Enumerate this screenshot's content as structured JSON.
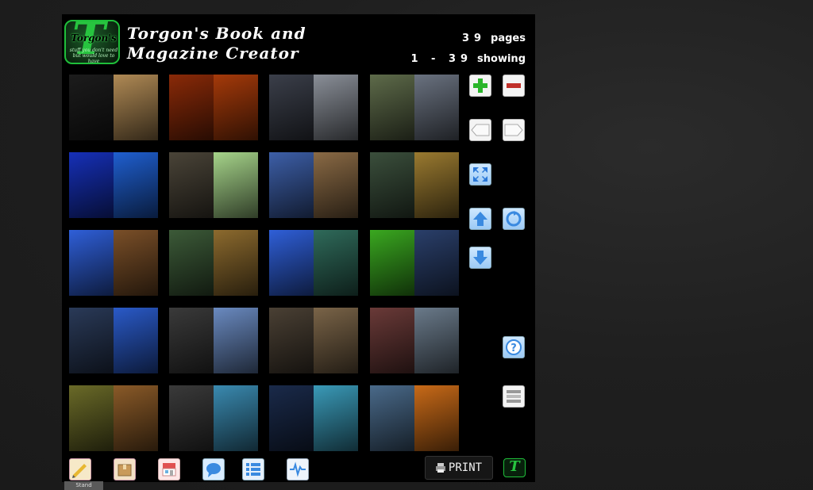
{
  "header": {
    "logo_word": "Torgon's",
    "logo_tagline": "stuff you don't need but would love to have",
    "title_line1": "Torgon's Book and",
    "title_line2": "Magazine Creator",
    "pages_count": "39",
    "pages_label": "pages",
    "showing_range": "1 - 39",
    "showing_label": "showing"
  },
  "thumbnails": [
    {
      "name": "page-1-2",
      "left": "#1c1c1c",
      "right": "#b08a55"
    },
    {
      "name": "page-3-4",
      "left": "#8a2a08",
      "right": "#a53a0a"
    },
    {
      "name": "page-5-6",
      "left": "#3b3f4a",
      "right": "#8a8f98"
    },
    {
      "name": "page-7-8",
      "left": "#5e6b4a",
      "right": "#6a7280"
    },
    {
      "name": "page-9-10",
      "left": "#1630b8",
      "right": "#1f5fd0"
    },
    {
      "name": "page-11-12",
      "left": "#4a4438",
      "right": "#a6d48a"
    },
    {
      "name": "page-13-14",
      "left": "#3d5fa8",
      "right": "#8a6a45"
    },
    {
      "name": "page-15-16",
      "left": "#3b4f3c",
      "right": "#9a7a30"
    },
    {
      "name": "page-17-18",
      "left": "#2f5fd8",
      "right": "#7a4f28"
    },
    {
      "name": "page-19-20",
      "left": "#3c5a38",
      "right": "#8c6a2e"
    },
    {
      "name": "page-21-22",
      "left": "#2f5fd8",
      "right": "#2f6a5a"
    },
    {
      "name": "page-23-24",
      "left": "#3aa820",
      "right": "#2a3f6a"
    },
    {
      "name": "page-25-26",
      "left": "#2a3a58",
      "right": "#2a5ac8"
    },
    {
      "name": "page-27-28",
      "left": "#3a3a3a",
      "right": "#6a8ac0"
    },
    {
      "name": "page-29-30",
      "left": "#4a4034",
      "right": "#7a6448"
    },
    {
      "name": "page-31-32",
      "left": "#6a3a38",
      "right": "#6a7a8a"
    },
    {
      "name": "page-33-34",
      "left": "#6a6a28",
      "right": "#8a5a28"
    },
    {
      "name": "page-35-36",
      "left": "#3a3a3a",
      "right": "#3a8ab0"
    },
    {
      "name": "page-37-38",
      "left": "#1a2a4a",
      "right": "#3a9ab8"
    },
    {
      "name": "page-39-40",
      "left": "#4a6a8a",
      "right": "#c86a18"
    }
  ],
  "print_label": "PRINT",
  "stand_label": "Stand",
  "colors": {
    "panel_bg": "#000000",
    "brand_green": "#27c43f",
    "add_green": "#2bb52b",
    "remove_red": "#c0302a",
    "nav_blue": "#3a8ae0"
  }
}
